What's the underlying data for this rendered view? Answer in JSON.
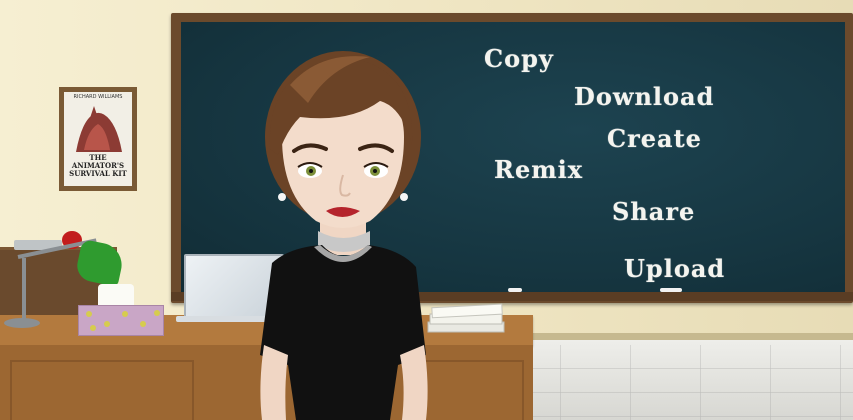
{
  "scene": {
    "board_words": [
      "Copy",
      "Download",
      "Create",
      "Remix",
      "Share",
      "Upload"
    ],
    "poster": {
      "line1": "RICHARD WILLIAMS",
      "line2": "THE ANIMATOR'S SURVIVAL KIT"
    },
    "colors": {
      "chalkboard": "#163641",
      "chalk_text": "#f4f4ef",
      "frame": "#6b4a2c",
      "wall": "#efe5c2",
      "desk": "#b37a3e",
      "dress": "#111111",
      "hair": "#6b4326"
    }
  }
}
